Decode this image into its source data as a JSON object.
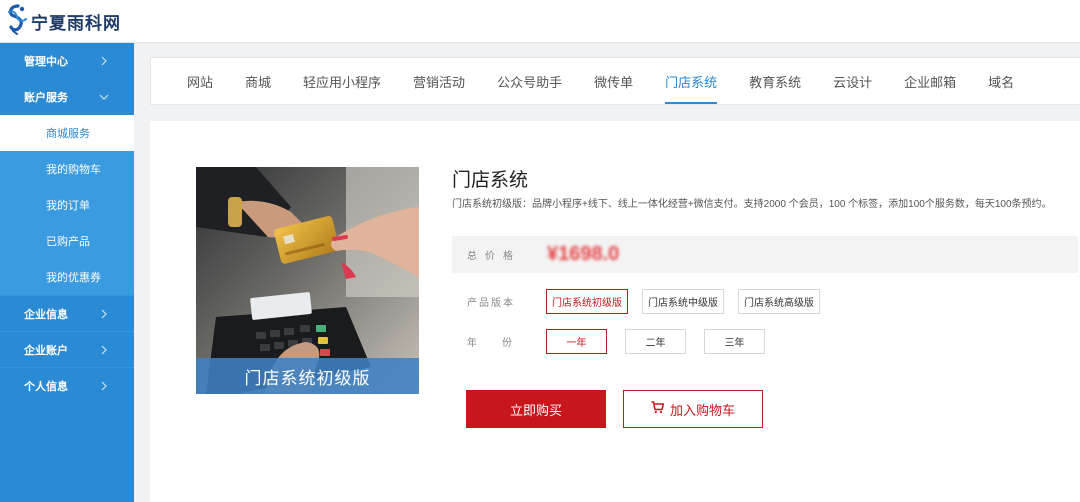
{
  "brand": {
    "name": "宁夏雨科网"
  },
  "sidebar": {
    "items": [
      {
        "label": "管理中心",
        "chevron": "right"
      },
      {
        "label": "账户服务",
        "chevron": "down",
        "children": [
          {
            "label": "商城服务",
            "active": true
          },
          {
            "label": "我的购物车"
          },
          {
            "label": "我的订单"
          },
          {
            "label": "已购产品"
          },
          {
            "label": "我的优惠券"
          }
        ]
      },
      {
        "label": "企业信息",
        "chevron": "right"
      },
      {
        "label": "企业账户",
        "chevron": "right"
      },
      {
        "label": "个人信息",
        "chevron": "right"
      }
    ]
  },
  "tabs": [
    "网站",
    "商城",
    "轻应用小程序",
    "营销活动",
    "公众号助手",
    "微传单",
    "门店系统",
    "教育系统",
    "云设计",
    "企业邮箱",
    "域名"
  ],
  "active_tab": "门店系统",
  "product": {
    "image_caption": "门店系统初级版",
    "title": "门店系统",
    "description": "门店系统初级版：品牌小程序+线下、线上一体化经营+微信支付。支持2000 个会员，100 个标签，添加100个服务数，每天100条预约。",
    "price_label": "总价格",
    "price_value": "¥1698.0",
    "version_label": "产品版本",
    "versions": [
      "门店系统初级版",
      "门店系统中级版",
      "门店系统高级版"
    ],
    "selected_version": 0,
    "year_label": "年份",
    "years": [
      "一年",
      "二年",
      "三年"
    ],
    "selected_year": 0,
    "buy_label": "立即购买",
    "cart_label": "加入购物车"
  },
  "colors": {
    "sidebar": "#2a8ad4",
    "accent_blue": "#2a8ad4",
    "accent_red": "#c8161d",
    "price": "#e2262a"
  },
  "icons": {
    "logo": "brand-logo-icon",
    "cart": "cart-icon",
    "chevron_right": "chevron-right-icon",
    "chevron_down": "chevron-down-icon"
  }
}
